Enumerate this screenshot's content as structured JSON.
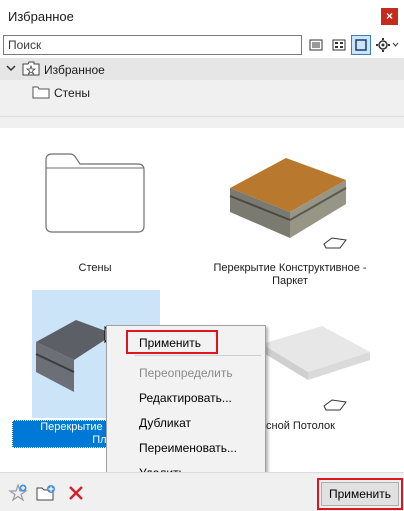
{
  "window": {
    "title": "Избранное",
    "close_icon": "close-icon"
  },
  "search": {
    "placeholder": "Поиск"
  },
  "view_buttons": [
    {
      "name": "list-view-icon"
    },
    {
      "name": "grid-view-icon"
    },
    {
      "name": "large-icon-view-icon",
      "active": true
    },
    {
      "name": "settings-gear-icon"
    }
  ],
  "tree": {
    "root": {
      "label": "Избранное",
      "icon": "star-folder-icon"
    },
    "children": [
      {
        "label": "Стены",
        "icon": "folder-icon"
      }
    ]
  },
  "tiles": [
    {
      "label": "Стены",
      "type": "folder"
    },
    {
      "label": "Перекрытие Конструктивное - Паркет",
      "line1": "Перекрытие Конструктивное -",
      "line2": "Паркет",
      "type": "slab"
    },
    {
      "line1": "Перекрытие Конс",
      "line2": "Плит",
      "type": "slab",
      "selected": true
    },
    {
      "line1": "сной Потолок",
      "type": "ceiling"
    }
  ],
  "context_menu": {
    "items": [
      {
        "label": "Применить",
        "highlighted": true
      },
      {
        "label": "Переопределить",
        "disabled": true
      },
      {
        "label": "Редактировать..."
      },
      {
        "label": "Дубликат"
      },
      {
        "label": "Переименовать..."
      },
      {
        "label": "Удалить..."
      }
    ]
  },
  "bottom": {
    "icons": [
      "add-favorite-icon",
      "new-folder-icon",
      "delete-icon"
    ],
    "apply_label": "Применить"
  },
  "colors": {
    "highlight_box": "#e0141e",
    "selection": "#0078d7",
    "close": "#c42b1c"
  }
}
